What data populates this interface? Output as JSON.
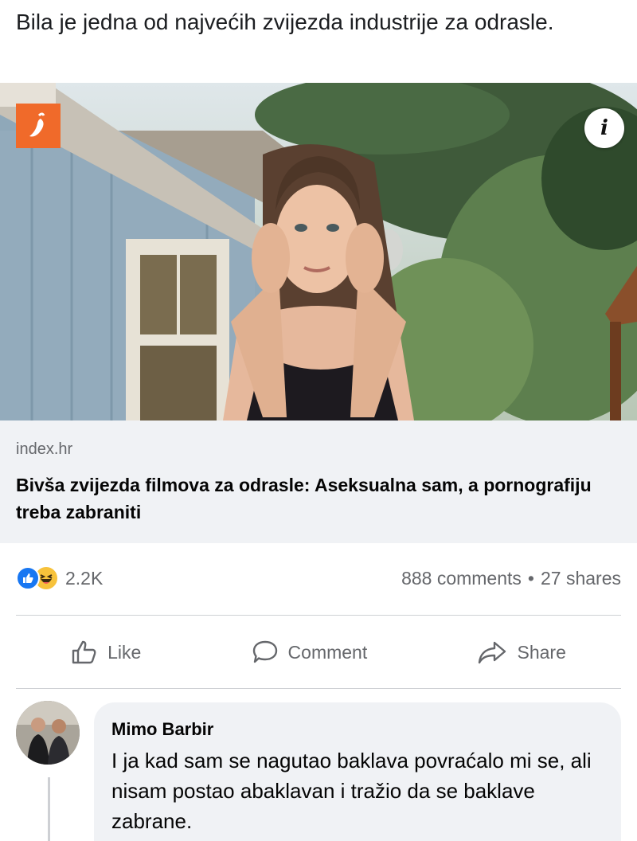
{
  "post": {
    "text": "Bila je jedna od najvećih zvijezda industrije za odrasle."
  },
  "link_preview": {
    "source_logo_icon": "chili-pepper-icon",
    "source_logo_color": "#f06a2a",
    "info_label": "i",
    "domain": "index.hr",
    "headline": "Bivša zvijezda filmova za odrasle: Aseksualna sam, a pornografiju treba zabraniti"
  },
  "stats": {
    "reaction_icons": [
      "like-reaction-icon",
      "haha-reaction-icon"
    ],
    "reaction_count": "2.2K",
    "comments": "888 comments",
    "separator": "•",
    "shares": "27 shares"
  },
  "actions": {
    "like_label": "Like",
    "comment_label": "Comment",
    "share_label": "Share"
  },
  "comment": {
    "author": "Mimo Barbir",
    "text": "I ja kad sam se nagutao baklava povraćalo mi se, ali nisam postao abaklavan i tražio da se baklave zabrane."
  },
  "colors": {
    "facebook_blue": "#1877f2",
    "secondary_text": "#65676b",
    "panel_bg": "#f0f2f5"
  }
}
